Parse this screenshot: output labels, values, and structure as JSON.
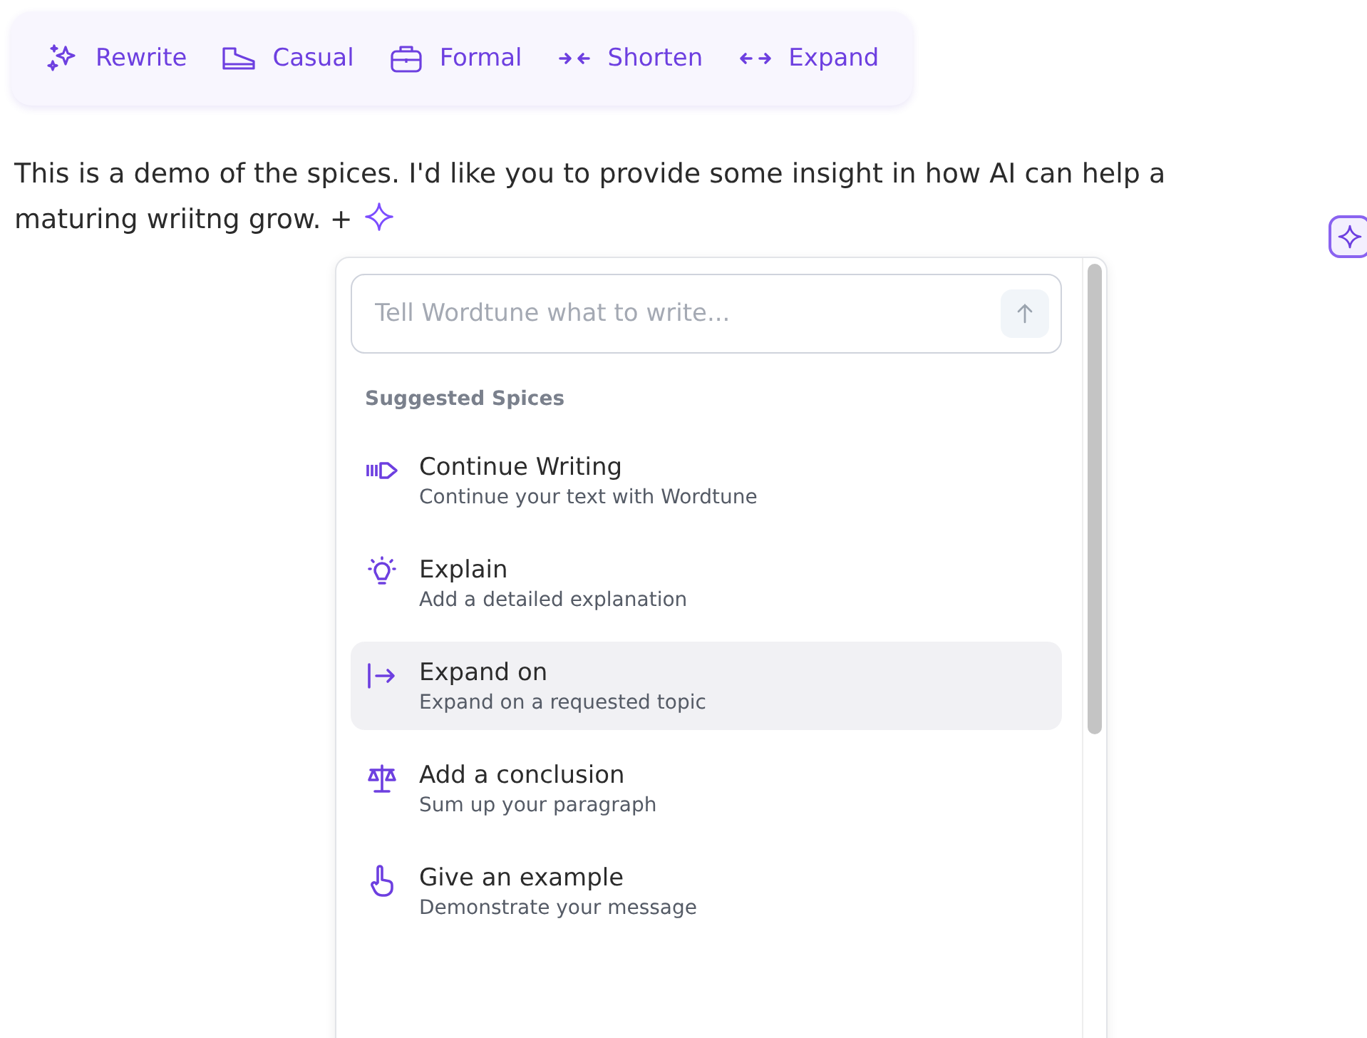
{
  "toolbar": [
    {
      "kind": "sparkles",
      "label": "Rewrite"
    },
    {
      "kind": "shoe",
      "label": "Casual"
    },
    {
      "kind": "briefcase",
      "label": "Formal"
    },
    {
      "kind": "shorten",
      "label": "Shorten"
    },
    {
      "kind": "expand",
      "label": "Expand"
    }
  ],
  "paragraph_lines": [
    "This is a demo of the spices. I'd like you to provide some insight in how AI can help a",
    "maturing wriitng grow. +"
  ],
  "spices_popup": {
    "prompt": {
      "placeholder": "Tell Wordtune what to write..."
    },
    "section_title": "Suggested Spices",
    "items": [
      {
        "kind": "continue",
        "title": "Continue Writing",
        "description": "Continue your text with Wordtune",
        "selected": false
      },
      {
        "kind": "bulb",
        "title": "Explain",
        "description": "Add a detailed explanation",
        "selected": false
      },
      {
        "kind": "expand",
        "title": "Expand on",
        "description": "Expand on a requested topic",
        "selected": true
      },
      {
        "kind": "scale",
        "title": "Add a conclusion",
        "description": "Sum up your paragraph",
        "selected": false
      },
      {
        "kind": "hand",
        "title": "Give an example",
        "description": "Demonstrate your message",
        "selected": false
      }
    ]
  }
}
